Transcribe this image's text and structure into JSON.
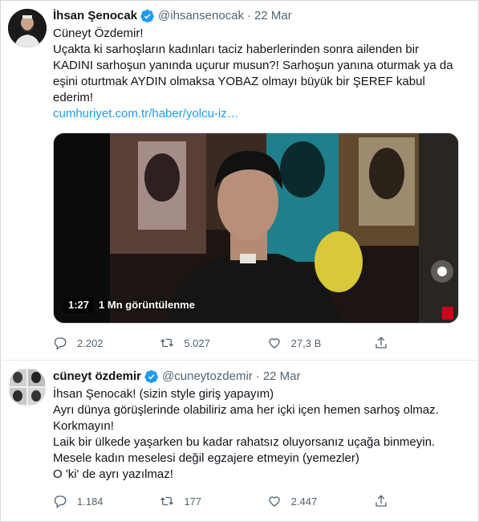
{
  "tweets": [
    {
      "author": {
        "name": "İhsan Şenocak",
        "handle": "@ihsansenocak",
        "date": "22 Mar"
      },
      "lines": [
        "Cüneyt Özdemir!",
        "Uçakta ki sarhoşların kadınları taciz haberlerinden sonra ailenden bir",
        "KADINI sarhoşun yanında uçurur musun?! Sarhoşun yanına oturmak ya da",
        "eşini oturtmak AYDIN olmaksa YOBAZ olmayı büyük bir ŞEREF kabul",
        "ederim!"
      ],
      "link": "cumhuriyet.com.tr/haber/yolcu-iz…",
      "video": {
        "duration": "1:27",
        "views": "1 Mn görüntülenme"
      },
      "actions": {
        "replies": "2.202",
        "retweets": "5.027",
        "likes": "27,3 B"
      }
    },
    {
      "author": {
        "name": "cüneyt özdemir",
        "handle": "@cuneytozdemir",
        "date": "22 Mar"
      },
      "lines": [
        "İhsan Şenocak! (sizin style giriş yapayım)",
        "Ayrı dünya görüşlerinde olabiliriz ama her içki içen hemen sarhoş olmaz.",
        "Korkmayın!",
        "Laik bir ülkede yaşarken bu kadar rahatsız oluyorsanız uçağa binmeyin.",
        "Mesele kadın meselesi değil egzajere etmeyin (yemezler)",
        "O 'ki' de ayrı yazılmaz!"
      ],
      "actions": {
        "replies": "1.184",
        "retweets": "177",
        "likes": "2.447"
      }
    }
  ],
  "colors": {
    "verified": "#1d9bf0",
    "link": "#1d9bf0",
    "muted": "#536471",
    "text": "#0f1419"
  },
  "icons": [
    "verified-badge-icon",
    "reply-icon",
    "retweet-icon",
    "like-icon",
    "share-icon"
  ]
}
